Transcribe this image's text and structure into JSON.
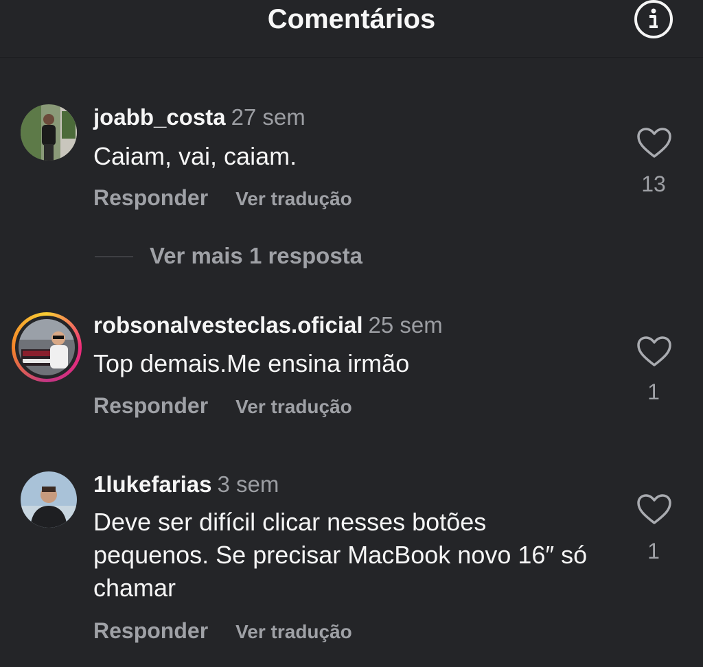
{
  "header": {
    "title": "Comentários",
    "info_icon": "info-circle-icon"
  },
  "comments": [
    {
      "username": "joabb_costa",
      "time": "27 sem",
      "text": "Caiam, vai, caiam.",
      "reply_label": "Responder",
      "translate_label": "Ver tradução",
      "likes": "13",
      "more_replies": "Ver mais 1 resposta"
    },
    {
      "username": "robsonalvesteclas.oficial",
      "time": "25 sem",
      "text": "Top demais.Me ensina irmão",
      "reply_label": "Responder",
      "translate_label": "Ver tradução",
      "likes": "1"
    },
    {
      "username": "1lukefarias",
      "time": "3 sem",
      "text": "Deve ser difícil clicar nesses botões pequenos. Se precisar MacBook novo 16″ só chamar",
      "reply_label": "Responder",
      "translate_label": "Ver tradução",
      "likes": "1"
    }
  ],
  "colors": {
    "background": "#242528",
    "secondary_text": "#9fa1a6",
    "primary_text": "#f5f5f5"
  }
}
